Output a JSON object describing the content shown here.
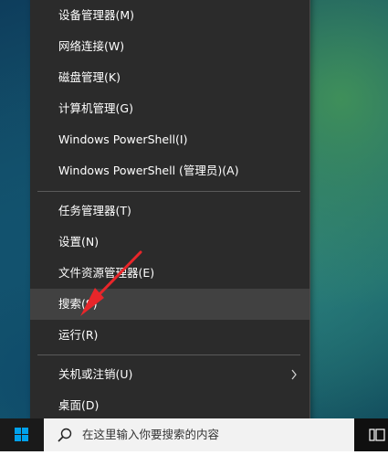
{
  "menu": {
    "items": [
      {
        "label": "设备管理器(M)"
      },
      {
        "label": "网络连接(W)"
      },
      {
        "label": "磁盘管理(K)"
      },
      {
        "label": "计算机管理(G)"
      },
      {
        "label": "Windows PowerShell(I)"
      },
      {
        "label": "Windows PowerShell (管理员)(A)"
      },
      {
        "label": "任务管理器(T)"
      },
      {
        "label": "设置(N)"
      },
      {
        "label": "文件资源管理器(E)"
      },
      {
        "label": "搜索(S)"
      },
      {
        "label": "运行(R)"
      },
      {
        "label": "关机或注销(U)"
      },
      {
        "label": "桌面(D)"
      }
    ]
  },
  "taskbar": {
    "search_placeholder": "在这里输入你要搜索的内容"
  },
  "colors": {
    "menu_bg": "#2b2b2b",
    "hover_bg": "#414141",
    "arrow": "#e8262a",
    "start_icon": "#00a2ed"
  }
}
